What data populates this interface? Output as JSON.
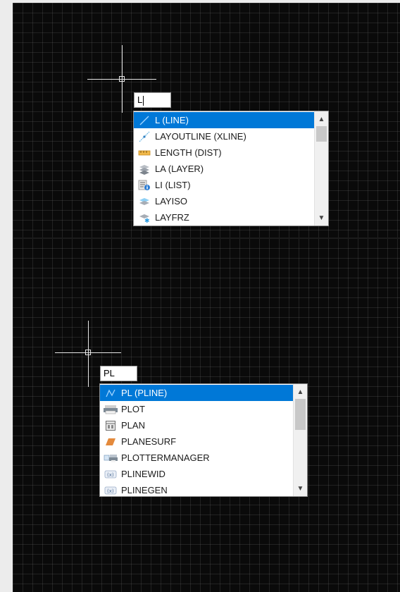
{
  "top_panel": {
    "command_input": "L",
    "autocomplete": [
      {
        "label": "L (LINE)",
        "icon": "line-icon",
        "selected": true
      },
      {
        "label": "LAYOUTLINE (XLINE)",
        "icon": "xline-icon",
        "selected": false
      },
      {
        "label": "LENGTH (DIST)",
        "icon": "ruler-icon",
        "selected": false
      },
      {
        "label": "LA (LAYER)",
        "icon": "layer-icon",
        "selected": false
      },
      {
        "label": "LI (LIST)",
        "icon": "list-info-icon",
        "selected": false
      },
      {
        "label": "LAYISO",
        "icon": "layer-isolate-icon",
        "selected": false
      },
      {
        "label": "LAYFRZ",
        "icon": "layer-freeze-icon",
        "selected": false
      }
    ]
  },
  "bottom_panel": {
    "command_input": "PL",
    "autocomplete": [
      {
        "label": "PL (PLINE)",
        "icon": "polyline-icon",
        "selected": true
      },
      {
        "label": "PLOT",
        "icon": "plot-icon",
        "selected": false
      },
      {
        "label": "PLAN",
        "icon": "plan-icon",
        "selected": false
      },
      {
        "label": "PLANESURF",
        "icon": "planesurf-icon",
        "selected": false
      },
      {
        "label": "PLOTTERMANAGER",
        "icon": "plotter-manager-icon",
        "selected": false
      },
      {
        "label": "PLINEWID",
        "icon": "system-variable-icon",
        "selected": false
      },
      {
        "label": "PLINEGEN",
        "icon": "system-variable-icon",
        "selected": false
      }
    ]
  },
  "colors": {
    "canvas_background": "#0a0a0a",
    "selection": "#0078d7",
    "crosshair": "#e6e6e6"
  }
}
